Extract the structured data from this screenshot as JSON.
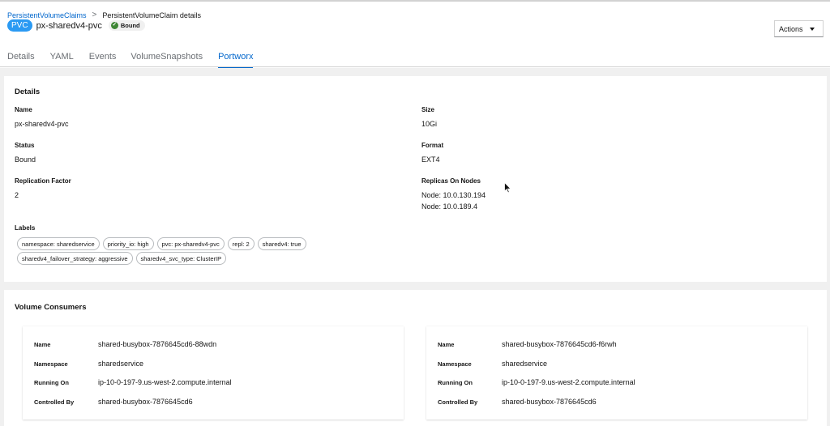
{
  "breadcrumb": {
    "parent": "PersistentVolumeClaims",
    "separator": ">",
    "current": "PersistentVolumeClaim details"
  },
  "header": {
    "badge": "PVC",
    "name": "px-sharedv4-pvc",
    "status": "Bound",
    "status_icon": "check-circle-icon",
    "actions_label": "Actions"
  },
  "tabs": [
    {
      "label": "Details",
      "active": false
    },
    {
      "label": "YAML",
      "active": false
    },
    {
      "label": "Events",
      "active": false
    },
    {
      "label": "VolumeSnapshots",
      "active": false
    },
    {
      "label": "Portworx",
      "active": true
    }
  ],
  "details": {
    "title": "Details",
    "name_label": "Name",
    "name_value": "px-sharedv4-pvc",
    "status_label": "Status",
    "status_value": "Bound",
    "replication_label": "Replication Factor",
    "replication_value": "2",
    "size_label": "Size",
    "size_value": "10Gi",
    "format_label": "Format",
    "format_value": "EXT4",
    "replicas_label": "Replicas On Nodes",
    "replicas": [
      "Node: 10.0.130.194",
      "Node: 10.0.189.4"
    ],
    "labels_label": "Labels",
    "labels_row1": [
      "namespace: sharedservice",
      "priority_io: high",
      "pvc: px-sharedv4-pvc",
      "repl: 2",
      "sharedv4: true"
    ],
    "labels_row2": [
      "sharedv4_failover_strategy: aggressive",
      "sharedv4_svc_type: ClusterIP"
    ]
  },
  "consumers": {
    "title": "Volume Consumers",
    "keys": {
      "name": "Name",
      "namespace": "Namespace",
      "running_on": "Running On",
      "controlled_by": "Controlled By"
    },
    "items": [
      {
        "name": "shared-busybox-7876645cd6-88wdn",
        "namespace": "sharedservice",
        "running_on": "ip-10-0-197-9.us-west-2.compute.internal",
        "controlled_by": "shared-busybox-7876645cd6"
      },
      {
        "name": "shared-busybox-7876645cd6-f6rwh",
        "namespace": "sharedservice",
        "running_on": "ip-10-0-197-9.us-west-2.compute.internal",
        "controlled_by": "shared-busybox-7876645cd6"
      }
    ]
  },
  "colors": {
    "accent": "#0066cc",
    "badge": "#2b9af3",
    "success": "#3e8635"
  }
}
